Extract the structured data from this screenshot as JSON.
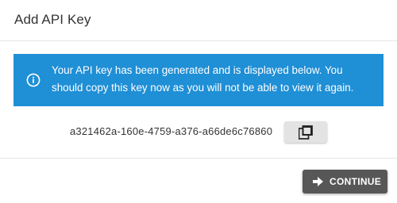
{
  "dialog": {
    "title": "Add API Key"
  },
  "alert": {
    "icon": "info-icon",
    "message": "Your API key has been generated and is displayed below. You should copy this key now as you will not be able to view it again.",
    "background_color": "#1f8fd6"
  },
  "api_key": {
    "value": "a321462a-160e-4759-a376-a66de6c76860",
    "copy_icon": "copy-icon"
  },
  "footer": {
    "continue_label": "CONTINUE",
    "continue_icon": "arrow-right-icon",
    "button_color": "#575757"
  }
}
